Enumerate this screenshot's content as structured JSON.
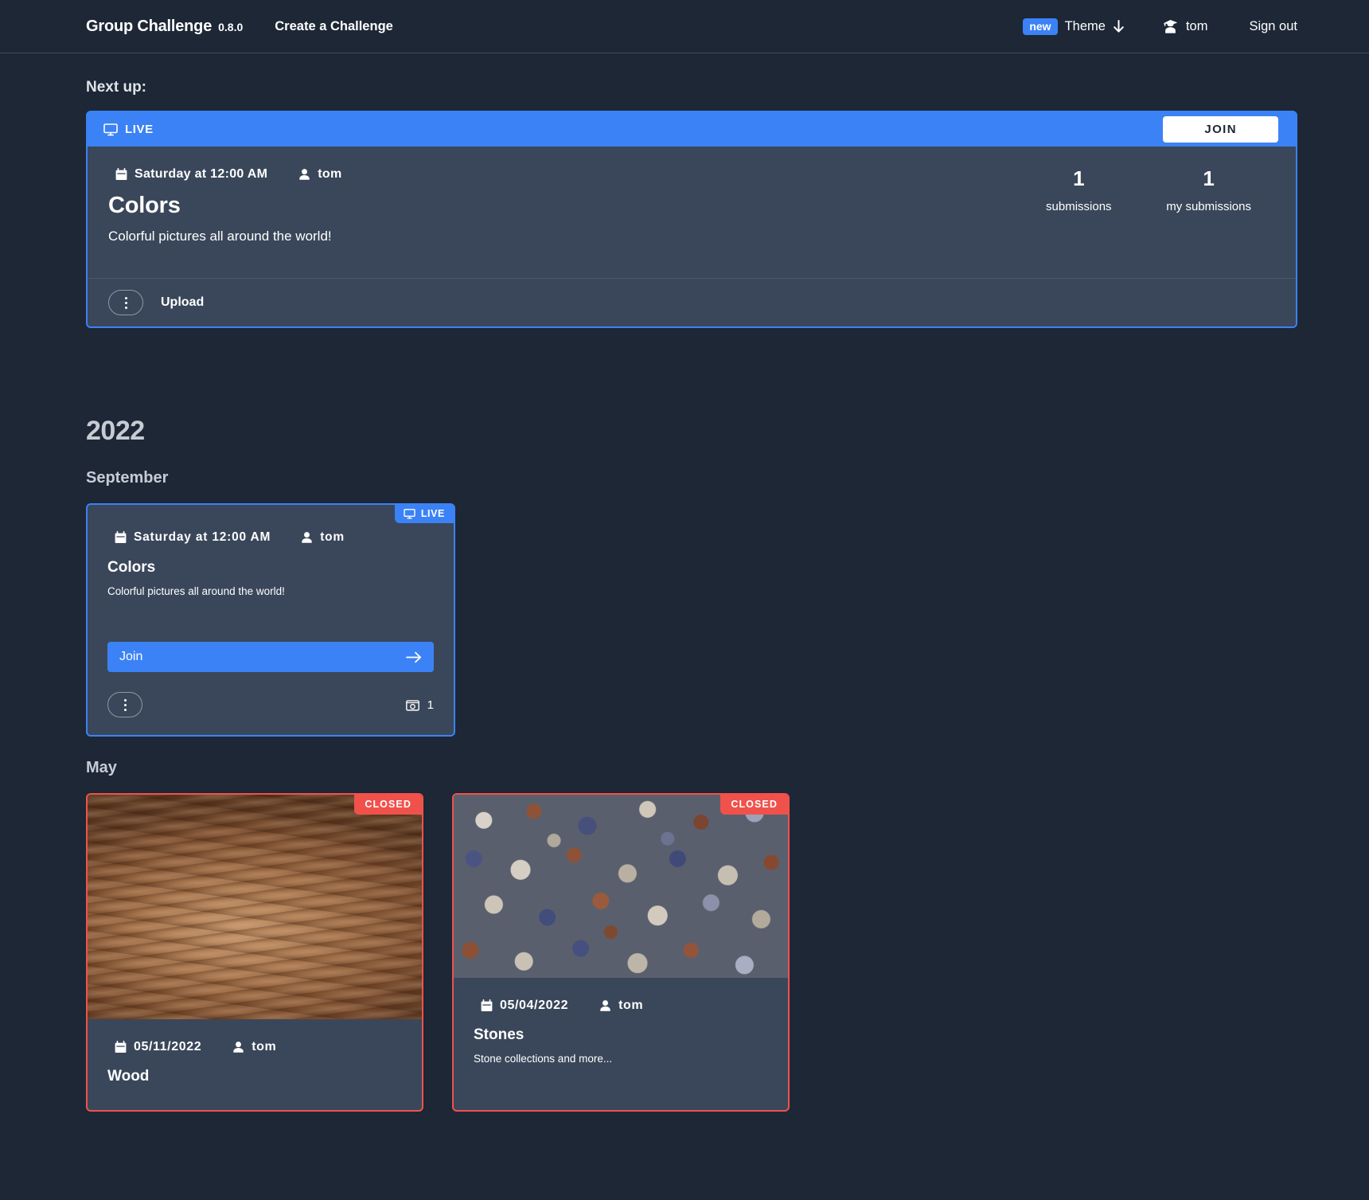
{
  "header": {
    "brand": "Group Challenge",
    "version": "0.8.0",
    "create_link": "Create a Challenge",
    "new_badge": "new",
    "theme_label": "Theme",
    "theme_icon": "arrow-down-icon",
    "user_icon": "user-graduate-icon",
    "username": "tom",
    "signout": "Sign out"
  },
  "next_up": {
    "section_label": "Next up:",
    "status": "LIVE",
    "status_icon": "desktop-icon",
    "join_label": "JOIN",
    "date": "Saturday at 12:00 AM",
    "date_icon": "calendar-icon",
    "author": "tom",
    "author_icon": "user-icon",
    "title": "Colors",
    "description": "Colorful pictures all around the world!",
    "stats": [
      {
        "value": "1",
        "label": "submissions"
      },
      {
        "value": "1",
        "label": "my submissions"
      }
    ],
    "menu_icon": "kebab-menu-icon",
    "upload_label": "Upload"
  },
  "timeline": {
    "year": "2022",
    "months": [
      {
        "name": "September",
        "cards": [
          {
            "kind": "live",
            "status": "LIVE",
            "status_icon": "desktop-icon",
            "date": "Saturday at 12:00 AM",
            "date_icon": "calendar-icon",
            "author": "tom",
            "author_icon": "user-icon",
            "title": "Colors",
            "description": "Colorful pictures all around the world!",
            "join_label": "Join",
            "join_arrow_icon": "arrow-right-icon",
            "menu_icon": "kebab-menu-icon",
            "count_icon": "camera-icon",
            "count": "1"
          }
        ]
      },
      {
        "name": "May",
        "cards": [
          {
            "kind": "closed",
            "status": "CLOSED",
            "thumb": "wood-texture",
            "date": "05/11/2022",
            "date_icon": "calendar-icon",
            "author": "tom",
            "author_icon": "user-icon",
            "title": "Wood",
            "description": ""
          },
          {
            "kind": "closed",
            "status": "CLOSED",
            "thumb": "stone-texture",
            "date": "05/04/2022",
            "date_icon": "calendar-icon",
            "author": "tom",
            "author_icon": "user-icon",
            "title": "Stones",
            "description": "Stone collections and more..."
          }
        ]
      }
    ]
  },
  "colors": {
    "background": "#1d2736",
    "card": "#3a475a",
    "accent": "#3b82f6",
    "closed": "#f0524b",
    "muted_text": "#c7ccd4"
  }
}
